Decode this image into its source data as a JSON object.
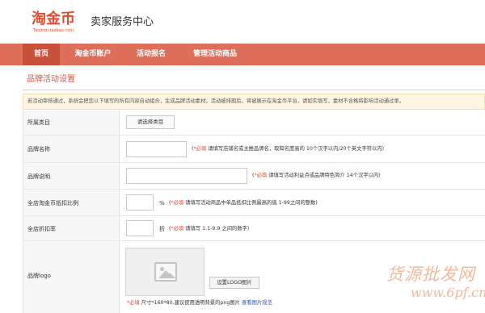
{
  "brand": {
    "logo_text": "淘金币",
    "logo_subtext": "Taojinbi.taobao.com",
    "site_title": "卖家服务中心",
    "accent": "#e9492a"
  },
  "nav": {
    "items": [
      {
        "label": "首页",
        "active": true
      },
      {
        "label": "淘金币账户",
        "active": false
      },
      {
        "label": "活动报名",
        "active": false
      },
      {
        "label": "管理活动商品",
        "active": false
      }
    ],
    "bg": "#dd6e5a"
  },
  "page": {
    "section_title": "品牌活动设置",
    "notice": "若活动审核通过，系统会把您以下填写的所有内容自动组合，生成品牌活动素材，活动被排期后，将被展示在淘金币平台，请如实填写，素材不合格将影响活动通过率。"
  },
  "form": {
    "category": {
      "label": "所属类目",
      "button": "请选择类目"
    },
    "brand_name": {
      "label": "品牌名称",
      "value": "",
      "req": "*必填",
      "hint": "请填写店铺名或主推品牌名，取知名度高的 10个汉字以内/20个英文字符以内)",
      "open": "("
    },
    "brand_desc": {
      "label": "品牌说明",
      "value": "",
      "open": "(",
      "req": "*必填",
      "hint": "请填写活动利益点或品牌特色简介 14个汉字以内)"
    },
    "deduct_ratio": {
      "label": "全店淘金币抵扣比例",
      "value": "",
      "unit": "%",
      "open": "(",
      "req": "*必填",
      "hint": "请填写活动商品中单品抵扣比例最高的值 1-99之间的整数)"
    },
    "discount": {
      "label": "全店折扣率",
      "value": "",
      "unit": "折",
      "open": "(",
      "req": "*必填",
      "hint": "请填写 1.1-9.9 之间的数字)"
    },
    "brand_logo": {
      "label": "品牌logo",
      "upload_button": "设置LOGO图片",
      "req": "*必填",
      "hint": "尺寸*160*80,建议使用透明背景的png图片",
      "link": "查看图片规范"
    }
  },
  "watermark": {
    "text": "货源批发网",
    "url": "www.6pf.cn"
  }
}
